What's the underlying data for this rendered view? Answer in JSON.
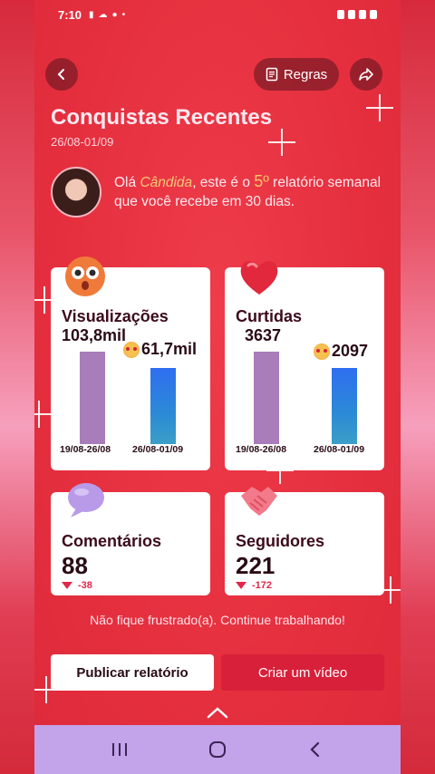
{
  "status_bar": {
    "time": "7:10"
  },
  "header": {
    "rules_label": "Regras"
  },
  "page": {
    "title": "Conquistas Recentes",
    "date_range": "26/08-01/09"
  },
  "greeting": {
    "prefix": "Olá ",
    "name": "Cândida",
    "middle": ", este é o ",
    "ordinal": "5º",
    "suffix": " relatório semanal que você recebe em 30 dias."
  },
  "cards": {
    "views": {
      "label": "Visualizações",
      "previous_value": "103,8mil",
      "current_value": "61,7mil",
      "previous_period": "19/08-26/08",
      "current_period": "26/08-01/09",
      "previous_numeric": 103.8,
      "current_numeric": 61.7
    },
    "likes": {
      "label": "Curtidas",
      "previous_value": "3637",
      "current_value": "2097",
      "previous_period": "19/08-26/08",
      "current_period": "26/08-01/09",
      "previous_numeric": 3637,
      "current_numeric": 2097
    },
    "comments": {
      "label": "Comentários",
      "value": "88",
      "delta": "-38"
    },
    "followers": {
      "label": "Seguidores",
      "value": "221",
      "delta": "-172"
    }
  },
  "message": "Não fique frustrado(a). Continue trabalhando!",
  "actions": {
    "publish_label": "Publicar relatório",
    "create_label": "Criar um vídeo"
  },
  "colors": {
    "background": "#e5303f",
    "card": "#ffffff",
    "bar_previous": "#a97cba",
    "bar_current": "#2f7fe0",
    "create_button": "#d8203a",
    "nav_bar": "#c3a3ea"
  }
}
